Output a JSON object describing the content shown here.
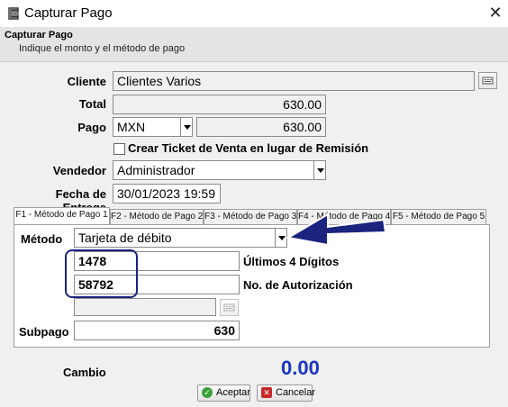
{
  "window": {
    "title": "Capturar Pago",
    "close_glyph": "✕",
    "icon": "app-icon"
  },
  "header": {
    "title": "Capturar Pago",
    "subtitle": "Indique el monto y el método de pago"
  },
  "form": {
    "cliente_label": "Cliente",
    "cliente_value": "Clientes Varios",
    "total_label": "Total",
    "total_value": "630.00",
    "pago_label": "Pago",
    "currency_value": "MXN",
    "pago_value": "630.00",
    "ticket_checkbox_label": "Crear Ticket de Venta en lugar de Remisión",
    "vendedor_label": "Vendedor",
    "vendedor_value": "Administrador",
    "fecha_label": "Fecha de Entrega",
    "fecha_value": "30/01/2023 19:59"
  },
  "tabs": [
    {
      "label": "F1 - Método de Pago 1"
    },
    {
      "label": "F2 - Método de Pago 2"
    },
    {
      "label": "F3 - Método de Pago 3"
    },
    {
      "label": "F4 - Método de Pago 4"
    },
    {
      "label": "F5 - Método de Pago 5"
    }
  ],
  "payment": {
    "metodo_label": "Método",
    "metodo_value": "Tarjeta de débito",
    "digits_value": "1478",
    "digits_label": "Últimos 4 Dígitos",
    "auth_value": "58792",
    "auth_label": "No. de Autorización",
    "extra_value": "",
    "subpago_label": "Subpago",
    "subpago_value": "630"
  },
  "footer": {
    "cambio_label": "Cambio",
    "cambio_value": "0.00",
    "accept_label": "Aceptar",
    "cancel_label": "Cancelar"
  },
  "colors": {
    "accent_blue": "#1a34c4",
    "annotation_blue": "#1a237e",
    "accept_green": "#3aa13a",
    "cancel_red": "#c62828"
  }
}
